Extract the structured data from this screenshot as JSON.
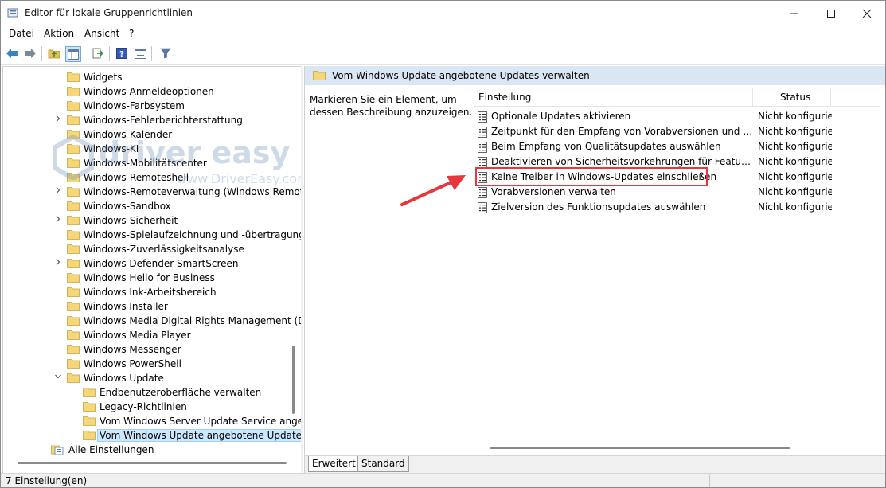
{
  "window": {
    "title": "Editor für lokale Gruppenrichtlinien"
  },
  "menu": [
    "Datei",
    "Aktion",
    "Ansicht",
    "?"
  ],
  "tree": [
    {
      "label": "Widgets",
      "chev": "",
      "level": 1
    },
    {
      "label": "Windows-Anmeldeoptionen",
      "chev": "",
      "level": 1
    },
    {
      "label": "Windows-Farbsystem",
      "chev": "",
      "level": 1
    },
    {
      "label": "Windows-Fehlerberichterstattung",
      "chev": ">",
      "level": 1
    },
    {
      "label": "Windows-Kalender",
      "chev": "",
      "level": 1
    },
    {
      "label": "Windows-KI",
      "chev": "",
      "level": 1
    },
    {
      "label": "Windows-Mobilitätscenter",
      "chev": "",
      "level": 1
    },
    {
      "label": "Windows-Remoteshell",
      "chev": "",
      "level": 1
    },
    {
      "label": "Windows-Remoteverwaltung (Windows Remote",
      "chev": ">",
      "level": 1
    },
    {
      "label": "Windows-Sandbox",
      "chev": "",
      "level": 1
    },
    {
      "label": "Windows-Sicherheit",
      "chev": ">",
      "level": 1
    },
    {
      "label": "Windows-Spielaufzeichnung und -übertragung",
      "chev": "",
      "level": 1
    },
    {
      "label": "Windows-Zuverlässigkeitsanalyse",
      "chev": "",
      "level": 1
    },
    {
      "label": "Windows Defender SmartScreen",
      "chev": ">",
      "level": 1
    },
    {
      "label": "Windows Hello for Business",
      "chev": "",
      "level": 1
    },
    {
      "label": "Windows Ink-Arbeitsbereich",
      "chev": "",
      "level": 1
    },
    {
      "label": "Windows Installer",
      "chev": "",
      "level": 1
    },
    {
      "label": "Windows Media Digital Rights Management (DR",
      "chev": "",
      "level": 1
    },
    {
      "label": "Windows Media Player",
      "chev": "",
      "level": 1
    },
    {
      "label": "Windows Messenger",
      "chev": "",
      "level": 1
    },
    {
      "label": "Windows PowerShell",
      "chev": "",
      "level": 1
    },
    {
      "label": "Windows Update",
      "chev": "v",
      "level": 1
    },
    {
      "label": "Endbenutzeroberfläche verwalten",
      "chev": "",
      "level": 2
    },
    {
      "label": "Legacy-Richtlinien",
      "chev": "",
      "level": 2
    },
    {
      "label": "Vom Windows Server Update Service angebo",
      "chev": "",
      "level": 2
    },
    {
      "label": "Vom Windows Update angebotene Updates v",
      "chev": "",
      "level": 2,
      "selected": true
    },
    {
      "label": "Alle Einstellungen",
      "chev": "",
      "level": 0,
      "special": true
    }
  ],
  "right": {
    "header": "Vom Windows Update angebotene Updates verwalten",
    "description": "Markieren Sie ein Element, um dessen Beschreibung anzuzeigen.",
    "col_setting": "Einstellung",
    "col_status": "Status",
    "settings": [
      {
        "name": "Optionale Updates aktivieren",
        "status": "Nicht konfiguriert"
      },
      {
        "name": "Zeitpunkt für den Empfang von Vorabversionen und Funktionsupdates auswählen",
        "status": "Nicht konfiguriert"
      },
      {
        "name": "Beim Empfang von Qualitätsupdates auswählen",
        "status": "Nicht konfiguriert"
      },
      {
        "name": "Deaktivieren von Sicherheitsvorkehrungen für Feature-Updates",
        "status": "Nicht konfiguriert"
      },
      {
        "name": "Keine Treiber in Windows-Updates einschließen",
        "status": "Nicht konfiguriert"
      },
      {
        "name": "Vorabversionen verwalten",
        "status": "Nicht konfiguriert"
      },
      {
        "name": "Zielversion des Funktionsupdates auswählen",
        "status": "Nicht konfiguriert"
      }
    ]
  },
  "tabs": [
    "Erweitert",
    "Standard"
  ],
  "status": "7 Einstellung(en)",
  "watermark": {
    "brand": "driver easy",
    "url": "www.DriverEasy.com"
  },
  "colors": {
    "accent": "#e8363c",
    "header_bg": "#d9e6f4",
    "selection": "#cce8ff",
    "folder": "#f5d77a"
  }
}
